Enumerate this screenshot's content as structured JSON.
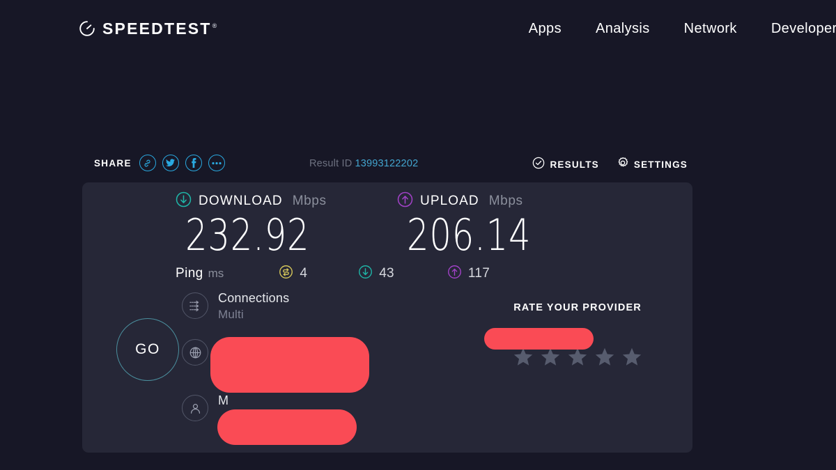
{
  "brand": {
    "name": "SPEEDTEST",
    "trademark": "®",
    "logo_icon": "speedometer-icon"
  },
  "nav": {
    "items": [
      {
        "label": "Apps"
      },
      {
        "label": "Analysis"
      },
      {
        "label": "Network"
      },
      {
        "label": "Developers"
      }
    ]
  },
  "toolbar": {
    "share_label": "SHARE",
    "share_buttons": [
      {
        "icon": "link-icon",
        "name": "share-link-button"
      },
      {
        "icon": "twitter-icon",
        "name": "share-twitter-button"
      },
      {
        "icon": "facebook-icon",
        "name": "share-facebook-button"
      },
      {
        "icon": "ellipsis-icon",
        "name": "share-more-button"
      }
    ],
    "result_id_label": "Result ID",
    "result_id_value": "13993122202",
    "results_label": "RESULTS",
    "results_icon": "check-circle-icon",
    "settings_label": "SETTINGS",
    "settings_icon": "gear-icon"
  },
  "results": {
    "download": {
      "title": "DOWNLOAD",
      "unit": "Mbps",
      "value": "232.92",
      "icon": "arrow-down-circle-icon",
      "color": "#1fb6a8"
    },
    "upload": {
      "title": "UPLOAD",
      "unit": "Mbps",
      "value": "206.14",
      "icon": "arrow-up-circle-icon",
      "color": "#a242c8"
    },
    "ping": {
      "label": "Ping",
      "unit": "ms",
      "idle": {
        "icon": "idle-latency-icon",
        "value": "4",
        "color": "#d7c85a"
      },
      "download": {
        "icon": "arrow-down-circle-icon",
        "value": "43",
        "color": "#1fb6a8"
      },
      "upload": {
        "icon": "arrow-up-circle-icon",
        "value": "117",
        "color": "#a242c8"
      }
    }
  },
  "go_button": {
    "label": "GO"
  },
  "connection_info": {
    "connections": {
      "icon": "multi-connections-icon",
      "title": "Connections",
      "value": "Multi"
    },
    "isp": {
      "icon": "globe-icon",
      "title": "",
      "value": "",
      "redacted": true
    },
    "server": {
      "icon": "person-icon",
      "title": "M",
      "value": "",
      "redacted": true
    }
  },
  "rate_provider": {
    "title": "RATE YOUR PROVIDER",
    "provider_name": "",
    "provider_redacted": true,
    "stars_total": 5,
    "stars_filled": 0
  },
  "colors": {
    "page_background": "#171726",
    "card_background": "#262737",
    "accent_teal": "#1fb6a8",
    "accent_purple": "#a242c8",
    "accent_blue": "#2aa9e0",
    "redaction_red": "#fa4b55",
    "star_grey": "#575c6e",
    "go_ring": "#4b8f9e"
  }
}
